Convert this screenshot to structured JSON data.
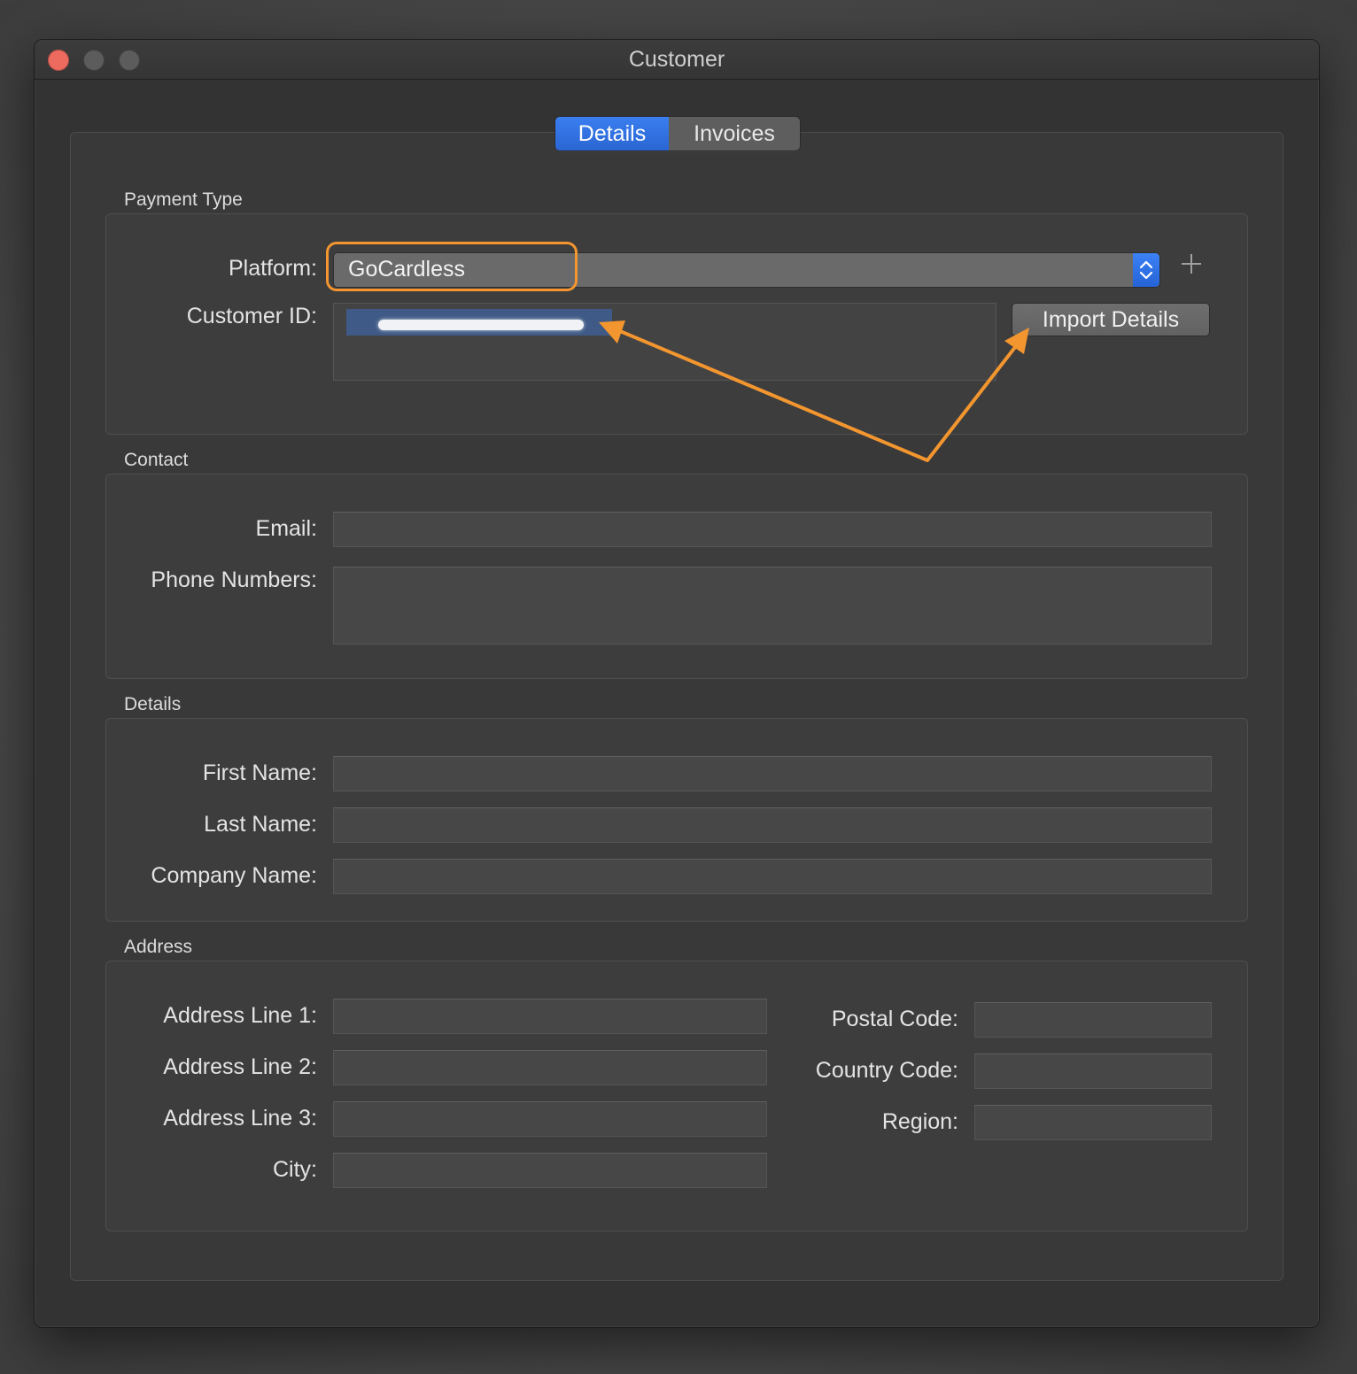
{
  "window": {
    "title": "Customer"
  },
  "tabs": [
    {
      "label": "Details",
      "active": true
    },
    {
      "label": "Invoices",
      "active": false
    }
  ],
  "payment_type": {
    "group_label": "Payment Type",
    "platform_label": "Platform:",
    "platform_value": "GoCardless",
    "customer_id_label": "Customer ID:",
    "customer_id_value": "",
    "import_button": "Import Details",
    "add_icon": "plus-icon"
  },
  "contact": {
    "group_label": "Contact",
    "email_label": "Email:",
    "email_value": "",
    "phone_label": "Phone Numbers:",
    "phone_value": ""
  },
  "details": {
    "group_label": "Details",
    "first_name_label": "First Name:",
    "first_name_value": "",
    "last_name_label": "Last Name:",
    "last_name_value": "",
    "company_label": "Company Name:",
    "company_value": ""
  },
  "address": {
    "group_label": "Address",
    "line1_label": "Address Line 1:",
    "line1_value": "",
    "line2_label": "Address Line 2:",
    "line2_value": "",
    "line3_label": "Address Line 3:",
    "line3_value": "",
    "city_label": "City:",
    "city_value": "",
    "postal_label": "Postal Code:",
    "postal_value": "",
    "country_label": "Country Code:",
    "country_value": "",
    "region_label": "Region:",
    "region_value": ""
  },
  "colors": {
    "accent": "#2a66d2",
    "annotation": "#f3962f",
    "close_button": "#ed6a5e"
  }
}
